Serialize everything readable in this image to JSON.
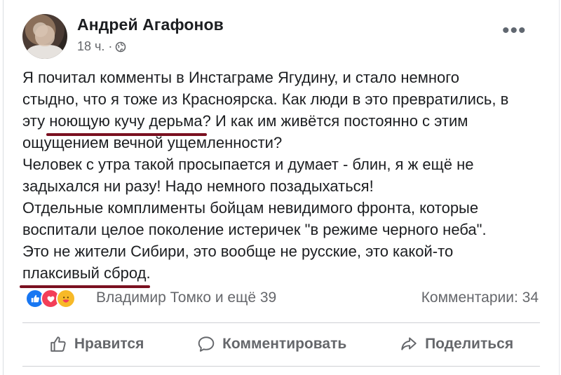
{
  "post": {
    "author": "Андрей Агафонов",
    "time": "18 ч. ·",
    "lines": [
      {
        "pre": "Я почитал комменты в Инстаграме Ягудину, и стало немного",
        "ul": "",
        "post": ""
      },
      {
        "pre": "стыдно, что я тоже из Красноярска. Как люди в это превратились, в",
        "ul": "",
        "post": ""
      },
      {
        "pre": "эту ",
        "ul": "ноющую кучу дерьма",
        "post": "? И как им живётся постоянно с этим"
      },
      {
        "pre": "ощущением вечной ущемленности?",
        "ul": "",
        "post": ""
      },
      {
        "pre": "Человек с утра такой просыпается и думает - блин, я ж ещё не",
        "ul": "",
        "post": ""
      },
      {
        "pre": "задыхался ни разу! Надо немного позадыхаться!",
        "ul": "",
        "post": ""
      },
      {
        "pre": "Отдельные комплименты бойцам невидимого фронта, которые",
        "ul": "",
        "post": ""
      },
      {
        "pre": "воспитали целое поколение истеричек \"в режиме черного неба\".",
        "ul": "",
        "post": ""
      },
      {
        "pre": "Это не жители Сибири, это вообще не русские, это какой-то",
        "ul": "",
        "post": ""
      },
      {
        "pre": "",
        "ul": "плаксивый сброд",
        "post": "."
      }
    ]
  },
  "reactions": {
    "icons": [
      "like-icon",
      "love-icon",
      "care-icon"
    ],
    "names": "Владимир Томко и ещё 39",
    "comments": "Комментарии: 34"
  },
  "actions": {
    "like": "Нравится",
    "comment": "Комментировать",
    "share": "Поделиться"
  },
  "colors": {
    "underline": "#7a1020",
    "secondary_text": "#65676b",
    "like_blue": "#1877f2",
    "love_red": "#f33e58",
    "care_yellow": "#f7b928"
  }
}
